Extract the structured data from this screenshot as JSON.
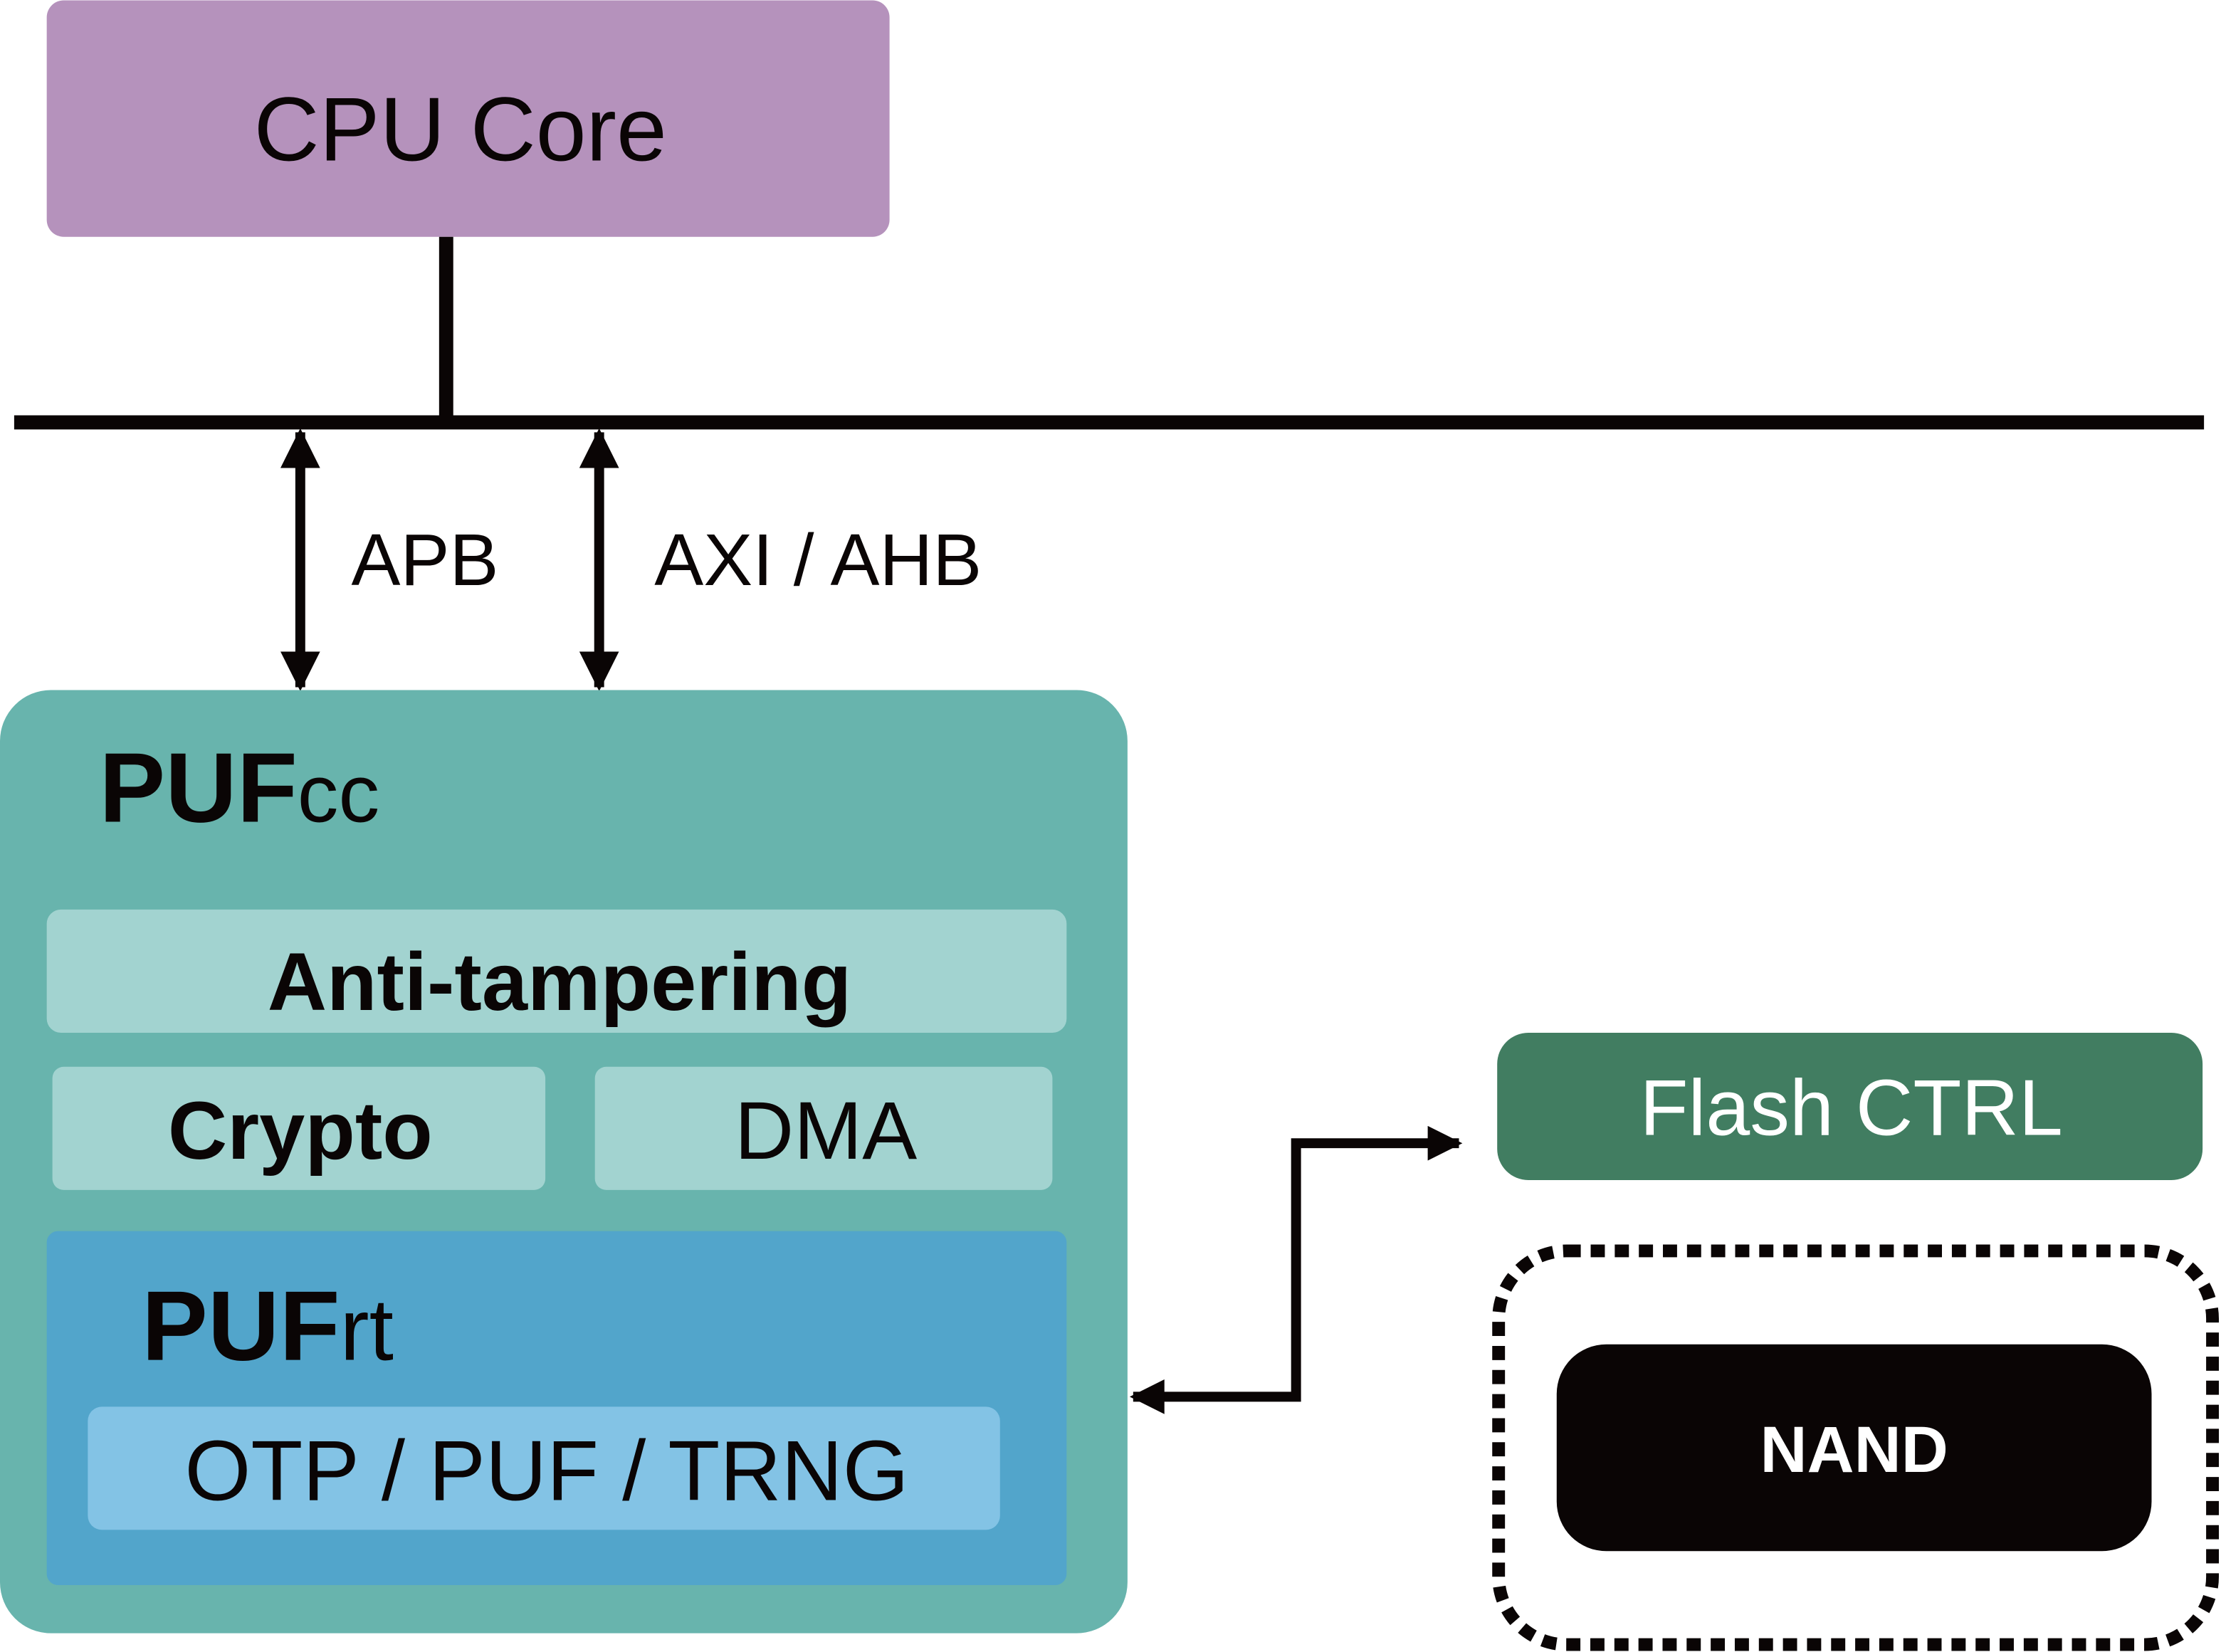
{
  "cpu": {
    "label": "CPU Core",
    "color": "#b592bc"
  },
  "bus": {
    "apb_label": "APB",
    "axi_label": "AXI / AHB"
  },
  "pufcc": {
    "title_main": "PUF",
    "title_sub": "cc",
    "color": "#68b4ad"
  },
  "anti_tampering": {
    "label": "Anti-tampering",
    "color": "#a2d3d0"
  },
  "crypto": {
    "label": "Crypto"
  },
  "dma": {
    "label": "DMA"
  },
  "pufrt": {
    "title_main": "PUF",
    "title_sub": "rt",
    "color": "#52a5cb"
  },
  "otp": {
    "label": "OTP / PUF / TRNG",
    "color": "#83c3e5"
  },
  "flash": {
    "label": "Flash CTRL",
    "color": "#417d61"
  },
  "nand": {
    "label": "NAND",
    "color": "#0a0505"
  }
}
